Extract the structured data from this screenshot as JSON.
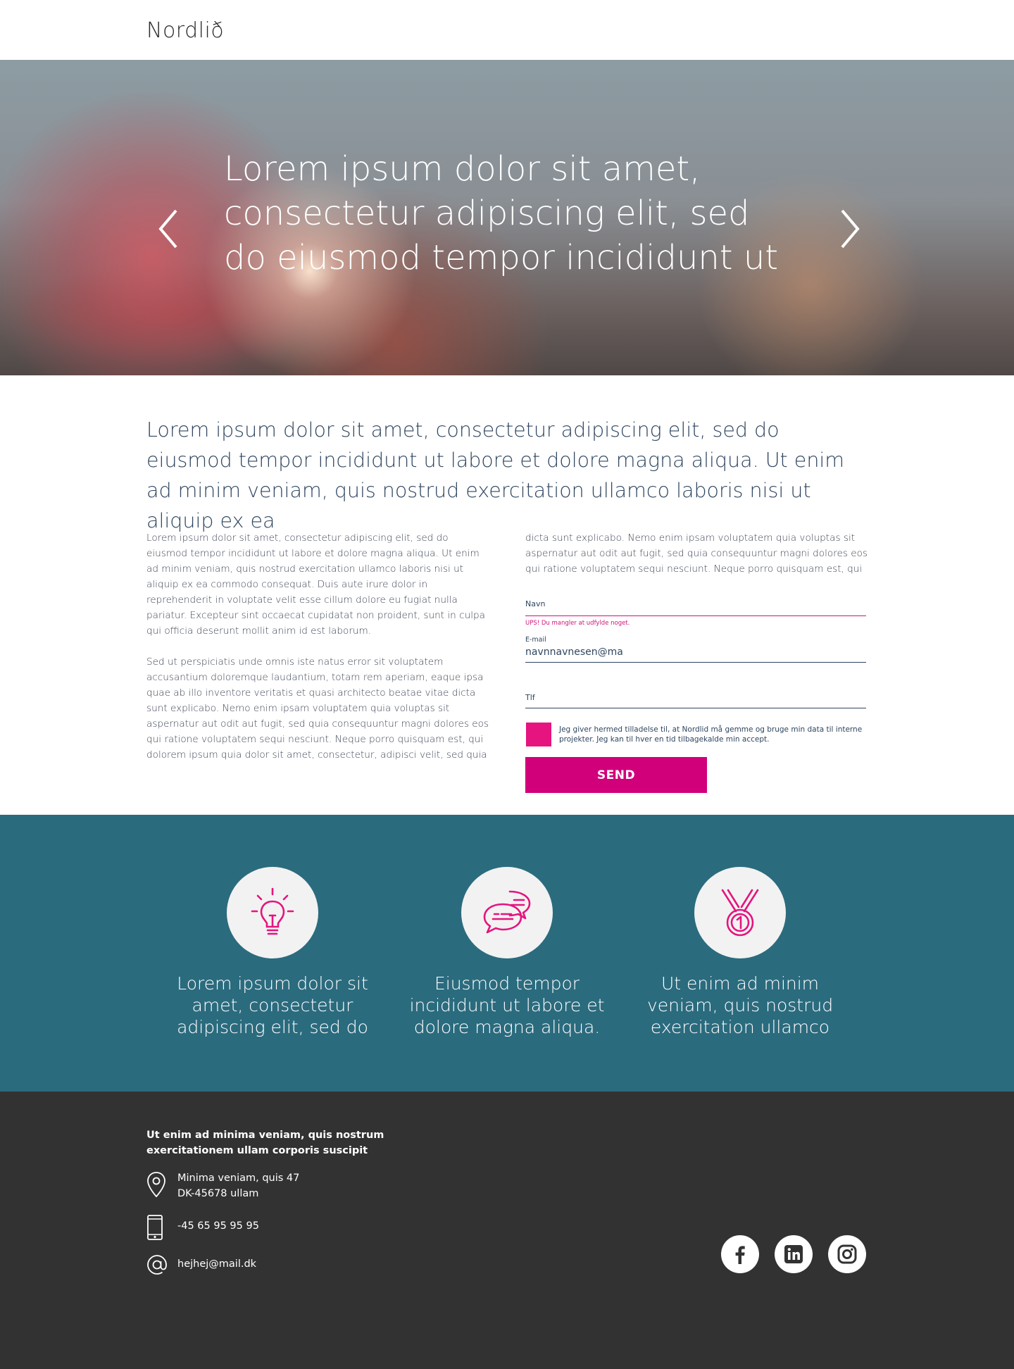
{
  "header": {
    "logo": "Nordlið"
  },
  "hero": {
    "title": "Lorem ipsum dolor sit amet, consectetur adipiscing elit, sed do eiusmod tempor incididunt ut",
    "prev_icon": "chevron-left-icon",
    "next_icon": "chevron-right-icon"
  },
  "intro": "Lorem ipsum dolor sit amet, consectetur adipiscing elit, sed do eiusmod tempor incididunt ut labore et dolore magna aliqua. Ut enim ad minim veniam, quis nostrud exercitation ullamco laboris nisi ut aliquip ex ea",
  "body": {
    "left_p1": "Lorem ipsum dolor sit amet, consectetur adipiscing elit, sed do eiusmod tempor incididunt ut labore et dolore magna aliqua. Ut enim ad minim veniam, quis nostrud exercitation ullamco laboris nisi ut aliquip ex ea commodo consequat. Duis aute irure dolor in reprehenderit in voluptate velit esse cillum dolore eu fugiat nulla pariatur. Excepteur sint occaecat cupidatat non proident, sunt in culpa qui officia deserunt mollit anim id est laborum.",
    "left_p2": "Sed ut perspiciatis unde omnis iste natus error sit voluptatem accusantium doloremque laudantium, totam rem aperiam, eaque ipsa quae ab illo inventore veritatis et quasi architecto beatae vitae dicta sunt explicabo. Nemo enim ipsam voluptatem quia voluptas sit aspernatur aut odit aut fugit, sed quia consequuntur magni dolores eos qui ratione voluptatem sequi nesciunt. Neque porro quisquam est, qui dolorem ipsum quia dolor sit amet, consectetur, adipisci velit, sed quia",
    "right_p1": "dicta sunt explicabo. Nemo enim ipsam voluptatem quia voluptas sit aspernatur aut odit aut fugit, sed quia consequuntur magni dolores eos qui ratione voluptatem sequi nesciunt. Neque porro quisquam est, qui"
  },
  "form": {
    "name_label": "Navn",
    "name_value": "",
    "name_error": "UPS! Du mangler at udfylde noget.",
    "email_label": "E-mail",
    "email_value": "navnnavnesen@ma",
    "phone_label": "Tlf",
    "phone_value": "",
    "consent_text": "Jeg giver hermed tilladelse til, at Nordlid må gemme og bruge min data til interne projekter. Jeg kan til hver en tid tilbagekalde min accept.",
    "send_label": "SEND",
    "accent_color": "#d1007a"
  },
  "features": {
    "background": "#2b6b7e",
    "items": [
      {
        "icon": "lightbulb-icon",
        "text": "Lorem ipsum dolor sit amet, consectetur adipiscing elit, sed do"
      },
      {
        "icon": "chat-bubbles-icon",
        "text": "Eiusmod tempor incididunt ut labore et dolore magna aliqua."
      },
      {
        "icon": "medal-icon",
        "text": "Ut enim ad minim veniam, quis nostrud exercitation ullamco"
      }
    ]
  },
  "footer": {
    "title": "Ut enim ad minima veniam, quis nostrum exercitationem ullam corporis suscipit",
    "address": "Minima veniam, quis 47\nDK-45678  ullam",
    "phone": "-45 65 95 95 95",
    "email": "hejhej@mail.dk",
    "address_icon": "location-pin-icon",
    "phone_icon": "phone-icon",
    "email_icon": "at-sign-icon",
    "social": [
      "facebook-icon",
      "linkedin-icon",
      "instagram-icon"
    ]
  }
}
